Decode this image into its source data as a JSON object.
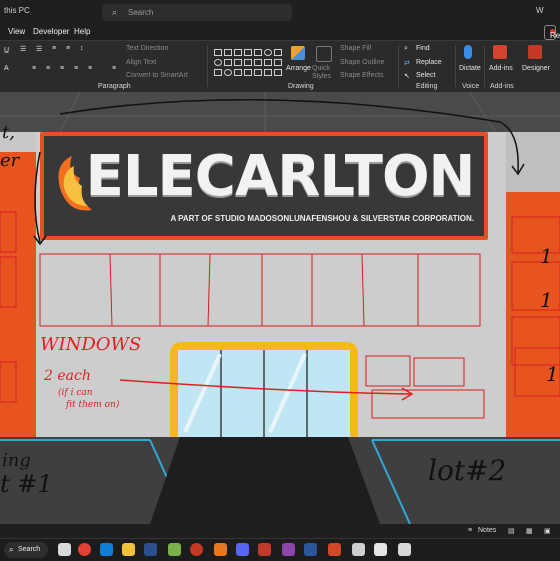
{
  "titlebar": {
    "location": "this PC",
    "search_placeholder": "Search",
    "window_title": "W"
  },
  "tabs": [
    "View",
    "Developer",
    "Help"
  ],
  "record_label": "Record",
  "ribbon": {
    "paragraph": {
      "label": "Paragraph",
      "text_direction": "Text Direction",
      "align_text": "Align Text",
      "convert_smartart": "Convert to SmartArt"
    },
    "drawing": {
      "label": "Drawing",
      "arrange": "Arrange",
      "quick_styles": "Quick Styles",
      "shape_fill": "Shape Fill",
      "shape_outline": "Shape Outline",
      "shape_effects": "Shape Effects"
    },
    "editing": {
      "label": "Editing",
      "find": "Find",
      "replace": "Replace",
      "select": "Select"
    },
    "voice": {
      "label": "Voice",
      "dictate": "Dictate"
    },
    "addins": {
      "label": "Add-ins",
      "addins_button": "Add-ins",
      "designer": "Designer"
    }
  },
  "slide": {
    "sign_title": "ELECARLTON",
    "sign_subtitle": "A PART OF STUDIO MADOSONLUNAFENSHOU & SILVERSTAR CORPORATION.",
    "annotations": {
      "windows": "WINDOWS",
      "two_each": "2 each",
      "if_i_can": "(if i can",
      "fit_them_on": "fit them on)",
      "lot1_a": "ing",
      "lot1_b": "t #1",
      "lot2": "lot#2",
      "left_top1": "t,",
      "left_top2": "er",
      "right_num1": "1",
      "right_num2": "1",
      "right_num3": "1"
    }
  },
  "statusbar": {
    "notes": "Notes"
  },
  "taskbar": {
    "search": "Search"
  },
  "colors": {
    "orange": "#e8541f",
    "sign_border": "#d9532a",
    "ink_red": "#e02020",
    "door_frame": "#f4b81c"
  }
}
